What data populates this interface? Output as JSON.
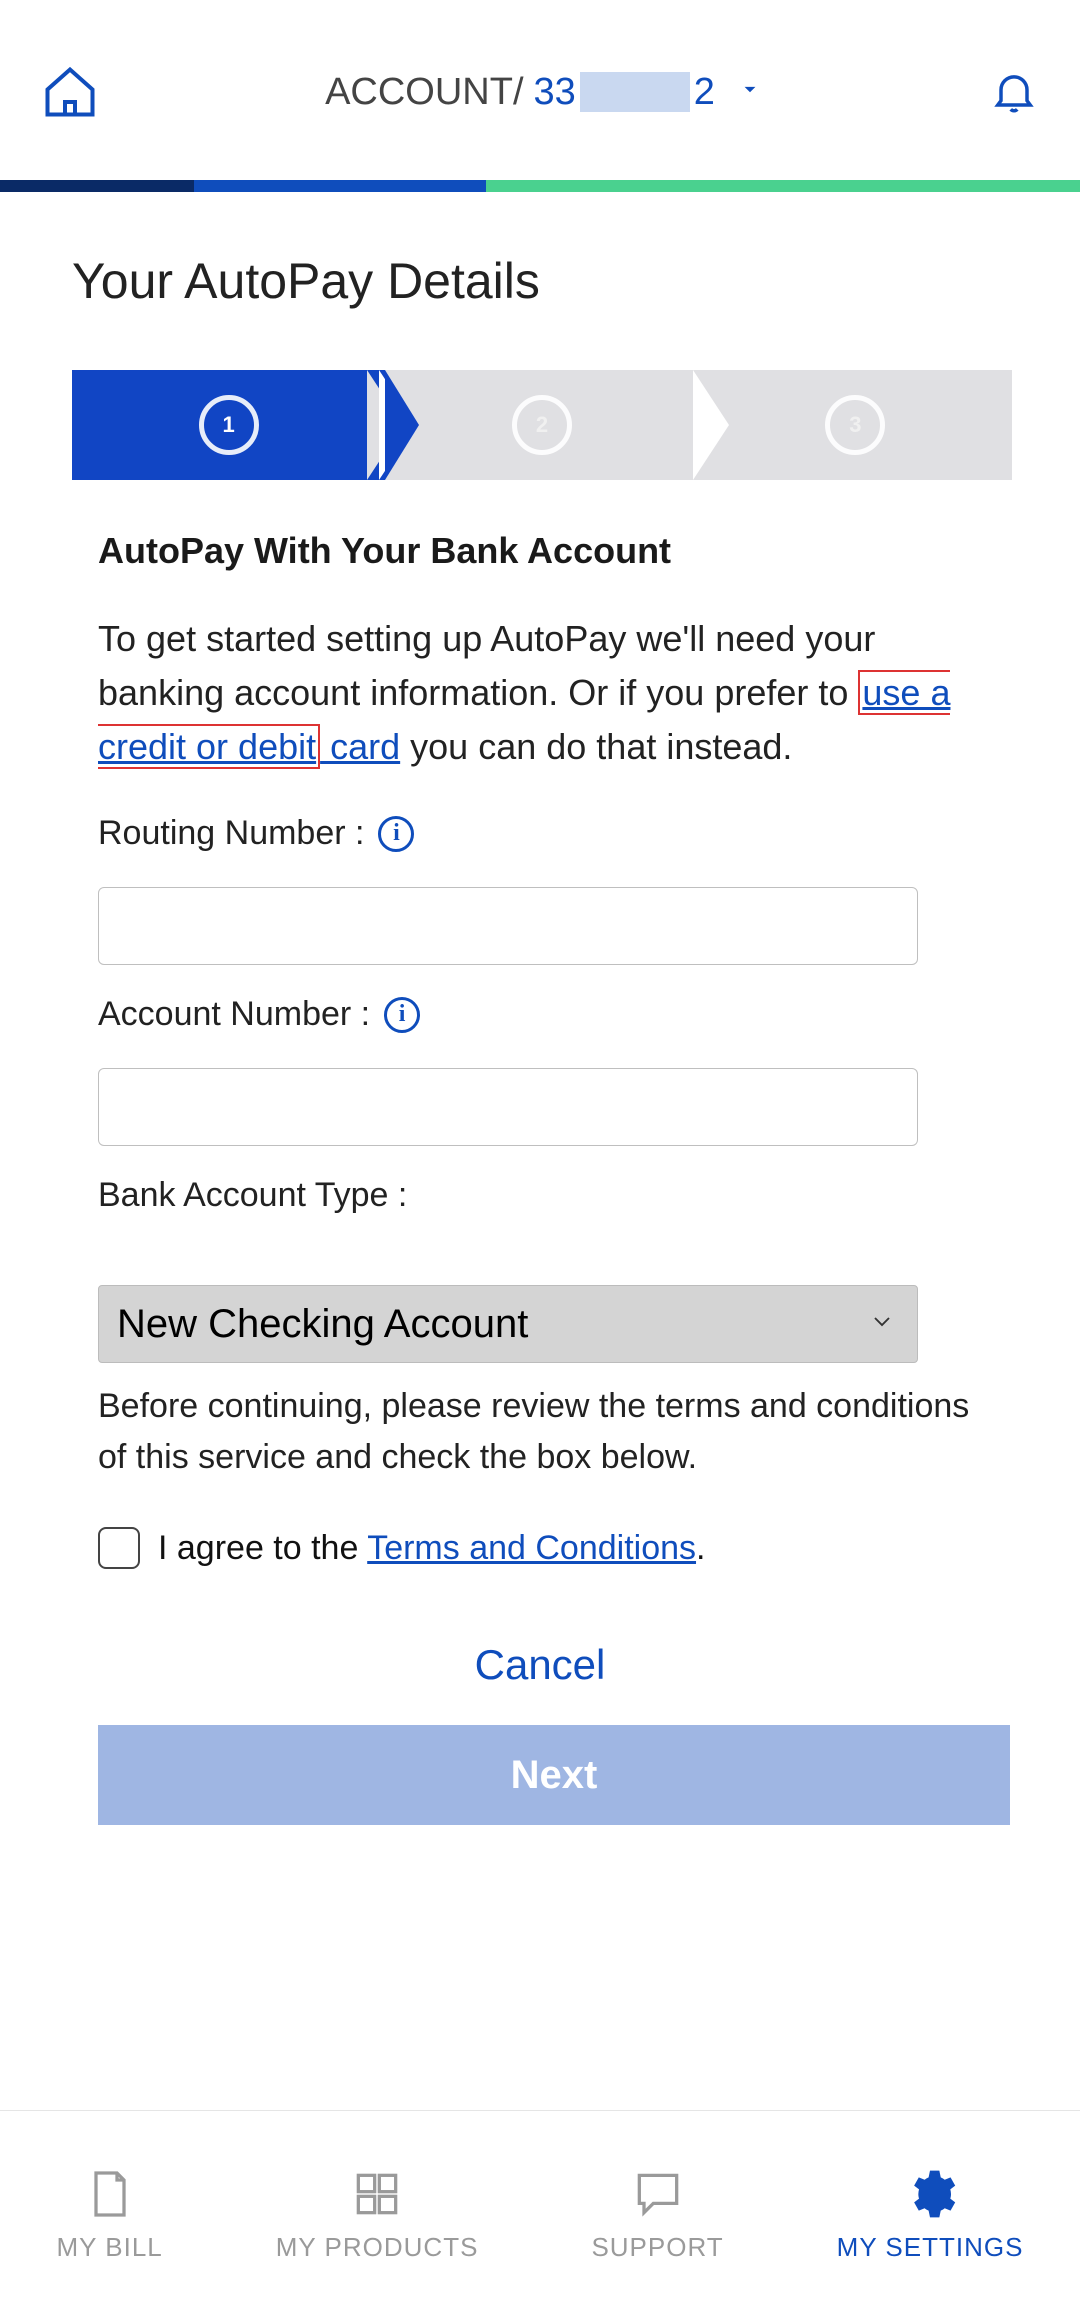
{
  "header": {
    "account_label_prefix": "ACCOUNT/",
    "account_prefix_digits": "33",
    "account_suffix_digit": "2"
  },
  "page": {
    "title": "Your AutoPay Details"
  },
  "steps": {
    "current": 1,
    "s1": "1",
    "s2": "2",
    "s3": "3"
  },
  "form": {
    "section_title": "AutoPay With Your Bank Account",
    "intro_pre": "To get started setting up AutoPay we'll need your banking account information. Or if you prefer to ",
    "intro_link_boxed": "use a credit or debit",
    "intro_link_rest": " card",
    "intro_post": " you can do that instead.",
    "routing_label": "Routing Number :",
    "routing_value": "",
    "account_label": "Account Number :",
    "account_value": "",
    "bank_type_label": "Bank Account Type :",
    "bank_type_selected": "New Checking Account",
    "terms_note": "Before continuing, please review the terms and conditions of this service and check the box below.",
    "agree_pre": " I agree to the ",
    "agree_link": "Terms and Conditions",
    "agree_post": ".",
    "cancel": "Cancel",
    "next": "Next"
  },
  "nav": {
    "bill": "MY BILL",
    "products": "MY PRODUCTS",
    "support": "SUPPORT",
    "settings": "MY SETTINGS"
  }
}
